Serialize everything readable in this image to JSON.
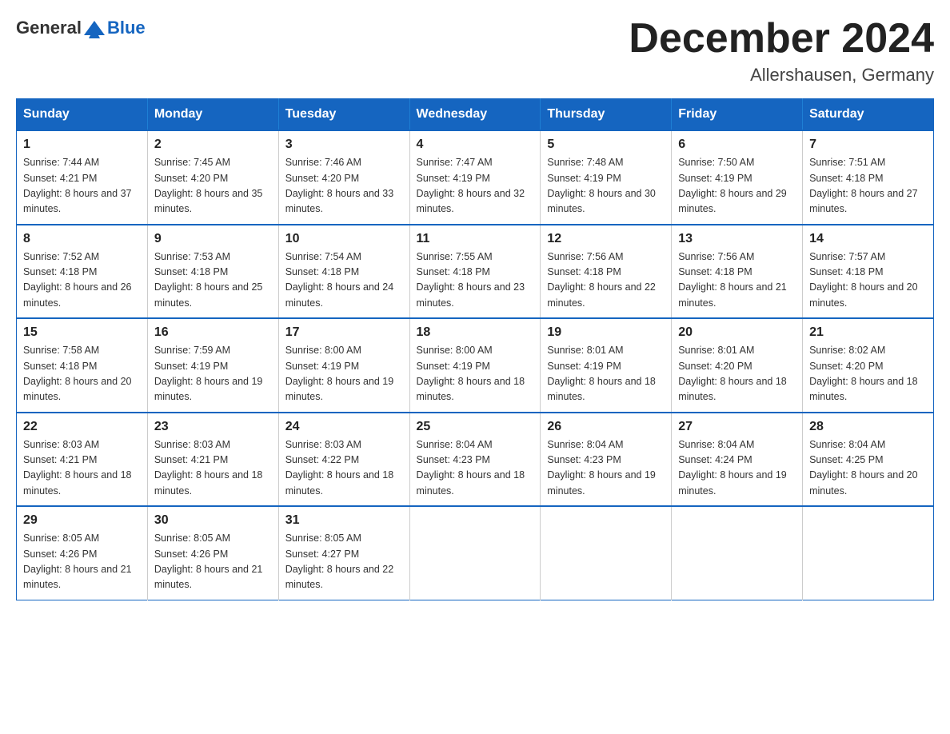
{
  "logo": {
    "text_general": "General",
    "text_blue": "Blue"
  },
  "title": "December 2024",
  "location": "Allershausen, Germany",
  "days_of_week": [
    "Sunday",
    "Monday",
    "Tuesday",
    "Wednesday",
    "Thursday",
    "Friday",
    "Saturday"
  ],
  "weeks": [
    [
      {
        "day": "1",
        "sunrise": "7:44 AM",
        "sunset": "4:21 PM",
        "daylight": "8 hours and 37 minutes."
      },
      {
        "day": "2",
        "sunrise": "7:45 AM",
        "sunset": "4:20 PM",
        "daylight": "8 hours and 35 minutes."
      },
      {
        "day": "3",
        "sunrise": "7:46 AM",
        "sunset": "4:20 PM",
        "daylight": "8 hours and 33 minutes."
      },
      {
        "day": "4",
        "sunrise": "7:47 AM",
        "sunset": "4:19 PM",
        "daylight": "8 hours and 32 minutes."
      },
      {
        "day": "5",
        "sunrise": "7:48 AM",
        "sunset": "4:19 PM",
        "daylight": "8 hours and 30 minutes."
      },
      {
        "day": "6",
        "sunrise": "7:50 AM",
        "sunset": "4:19 PM",
        "daylight": "8 hours and 29 minutes."
      },
      {
        "day": "7",
        "sunrise": "7:51 AM",
        "sunset": "4:18 PM",
        "daylight": "8 hours and 27 minutes."
      }
    ],
    [
      {
        "day": "8",
        "sunrise": "7:52 AM",
        "sunset": "4:18 PM",
        "daylight": "8 hours and 26 minutes."
      },
      {
        "day": "9",
        "sunrise": "7:53 AM",
        "sunset": "4:18 PM",
        "daylight": "8 hours and 25 minutes."
      },
      {
        "day": "10",
        "sunrise": "7:54 AM",
        "sunset": "4:18 PM",
        "daylight": "8 hours and 24 minutes."
      },
      {
        "day": "11",
        "sunrise": "7:55 AM",
        "sunset": "4:18 PM",
        "daylight": "8 hours and 23 minutes."
      },
      {
        "day": "12",
        "sunrise": "7:56 AM",
        "sunset": "4:18 PM",
        "daylight": "8 hours and 22 minutes."
      },
      {
        "day": "13",
        "sunrise": "7:56 AM",
        "sunset": "4:18 PM",
        "daylight": "8 hours and 21 minutes."
      },
      {
        "day": "14",
        "sunrise": "7:57 AM",
        "sunset": "4:18 PM",
        "daylight": "8 hours and 20 minutes."
      }
    ],
    [
      {
        "day": "15",
        "sunrise": "7:58 AM",
        "sunset": "4:18 PM",
        "daylight": "8 hours and 20 minutes."
      },
      {
        "day": "16",
        "sunrise": "7:59 AM",
        "sunset": "4:19 PM",
        "daylight": "8 hours and 19 minutes."
      },
      {
        "day": "17",
        "sunrise": "8:00 AM",
        "sunset": "4:19 PM",
        "daylight": "8 hours and 19 minutes."
      },
      {
        "day": "18",
        "sunrise": "8:00 AM",
        "sunset": "4:19 PM",
        "daylight": "8 hours and 18 minutes."
      },
      {
        "day": "19",
        "sunrise": "8:01 AM",
        "sunset": "4:19 PM",
        "daylight": "8 hours and 18 minutes."
      },
      {
        "day": "20",
        "sunrise": "8:01 AM",
        "sunset": "4:20 PM",
        "daylight": "8 hours and 18 minutes."
      },
      {
        "day": "21",
        "sunrise": "8:02 AM",
        "sunset": "4:20 PM",
        "daylight": "8 hours and 18 minutes."
      }
    ],
    [
      {
        "day": "22",
        "sunrise": "8:03 AM",
        "sunset": "4:21 PM",
        "daylight": "8 hours and 18 minutes."
      },
      {
        "day": "23",
        "sunrise": "8:03 AM",
        "sunset": "4:21 PM",
        "daylight": "8 hours and 18 minutes."
      },
      {
        "day": "24",
        "sunrise": "8:03 AM",
        "sunset": "4:22 PM",
        "daylight": "8 hours and 18 minutes."
      },
      {
        "day": "25",
        "sunrise": "8:04 AM",
        "sunset": "4:23 PM",
        "daylight": "8 hours and 18 minutes."
      },
      {
        "day": "26",
        "sunrise": "8:04 AM",
        "sunset": "4:23 PM",
        "daylight": "8 hours and 19 minutes."
      },
      {
        "day": "27",
        "sunrise": "8:04 AM",
        "sunset": "4:24 PM",
        "daylight": "8 hours and 19 minutes."
      },
      {
        "day": "28",
        "sunrise": "8:04 AM",
        "sunset": "4:25 PM",
        "daylight": "8 hours and 20 minutes."
      }
    ],
    [
      {
        "day": "29",
        "sunrise": "8:05 AM",
        "sunset": "4:26 PM",
        "daylight": "8 hours and 21 minutes."
      },
      {
        "day": "30",
        "sunrise": "8:05 AM",
        "sunset": "4:26 PM",
        "daylight": "8 hours and 21 minutes."
      },
      {
        "day": "31",
        "sunrise": "8:05 AM",
        "sunset": "4:27 PM",
        "daylight": "8 hours and 22 minutes."
      },
      null,
      null,
      null,
      null
    ]
  ]
}
